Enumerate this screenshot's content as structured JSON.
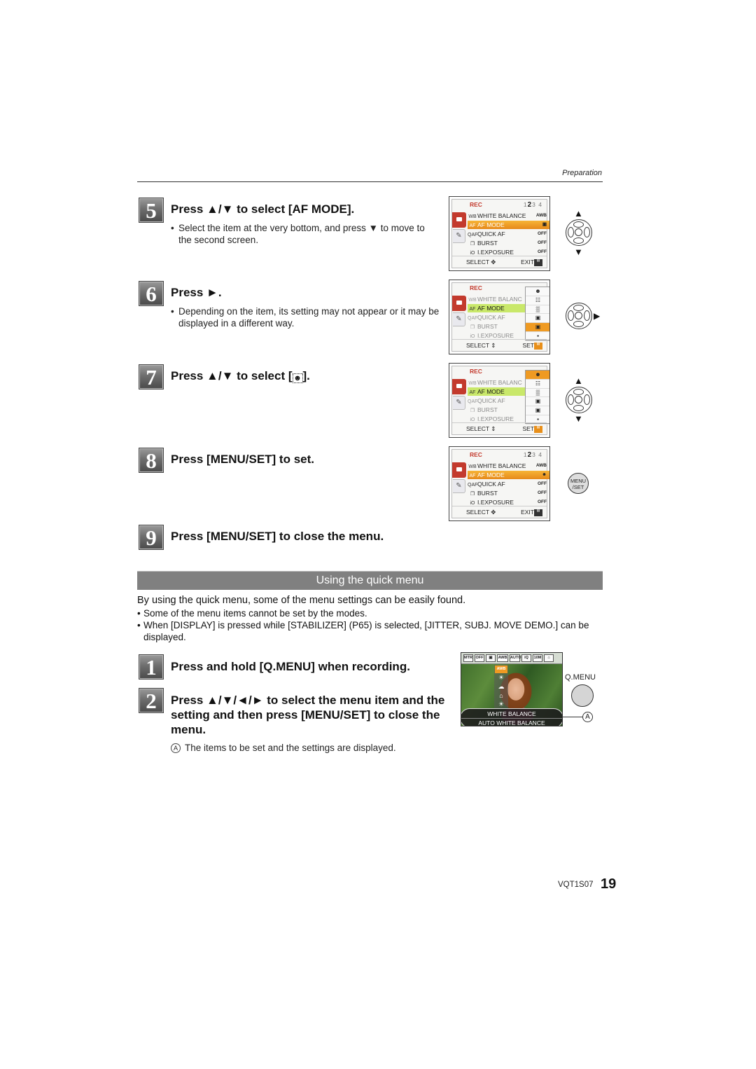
{
  "header": {
    "section": "Preparation"
  },
  "steps_top": [
    {
      "number": "5",
      "title": "Press ▲/▼ to select [AF MODE].",
      "note": "Select the item at the very bottom, and press ▼ to move to the second screen."
    },
    {
      "number": "6",
      "title": "Press ►.",
      "note": "Depending on the item, its setting may not appear or it may be displayed in a different way."
    },
    {
      "number": "7",
      "title": "Press ▲/▼ to select [",
      "title_icon": "face-detection-icon",
      "title_end": "]."
    },
    {
      "number": "8",
      "title": "Press [MENU/SET] to set."
    },
    {
      "number": "9",
      "title": "Press [MENU/SET] to close the menu."
    }
  ],
  "lcd": {
    "header": "REC",
    "pages": {
      "before": "1",
      "current": "2",
      "after": "3 4"
    },
    "items": [
      {
        "icon": "WB",
        "label": "WHITE BALANCE",
        "label_short": "WHITE BALANC",
        "value": "AWB"
      },
      {
        "icon": "AF",
        "label": "AF MODE",
        "value_screen1": "▣",
        "value_screen4": "☻"
      },
      {
        "icon": "QAF",
        "label": "QUICK AF",
        "value": "OFF"
      },
      {
        "icon": "❐",
        "label": "BURST",
        "value": "OFF"
      },
      {
        "icon": "iO",
        "label": "I.EXPOSURE",
        "value": "OFF"
      }
    ],
    "af_options": [
      "☻",
      "☷",
      "▒",
      "▣",
      "▣",
      "▪"
    ],
    "footer_select": "SELECT",
    "footer_exit": "EXIT",
    "footer_set": "SET",
    "menu_icon_text": "MENU SET"
  },
  "controls": {
    "up": "▲",
    "down": "▼",
    "right": "▶",
    "menu_button": "MENU\n/SET",
    "menu_line1": "MENU",
    "menu_line2": "/SET"
  },
  "quick_menu": {
    "heading": "Using the quick menu",
    "intro": "By using the quick menu, some of the menu settings can be easily found.",
    "notes": [
      "Some of the menu items cannot be set by the modes.",
      "When [DISPLAY] is pressed while [STABILIZER] (P65) is selected, [JITTER, SUBJ. MOVE DEMO.] can be displayed."
    ],
    "steps": [
      {
        "number": "1",
        "title": "Press and hold [Q.MENU] when recording."
      },
      {
        "number": "2",
        "title": "Press ▲/▼/◄/► to select the menu item and the setting and then press [MENU/SET] to close the menu."
      }
    ],
    "callout_label": "A",
    "callout_note": "The items to be set and the settings are displayed.",
    "qmenu_label": "Q.MENU",
    "screen": {
      "top_icons": [
        "MTR",
        "OFF",
        "▣",
        "AWB",
        "AUTO",
        "iQ",
        "10M",
        "⌂"
      ],
      "selected": "AWB",
      "value_icons": [
        "☀",
        "☁",
        "⌂",
        "☀"
      ],
      "line1": "WHITE BALANCE",
      "line2": "AUTO WHITE BALANCE"
    }
  },
  "footer": {
    "code": "VQT1S07",
    "page": "19"
  }
}
